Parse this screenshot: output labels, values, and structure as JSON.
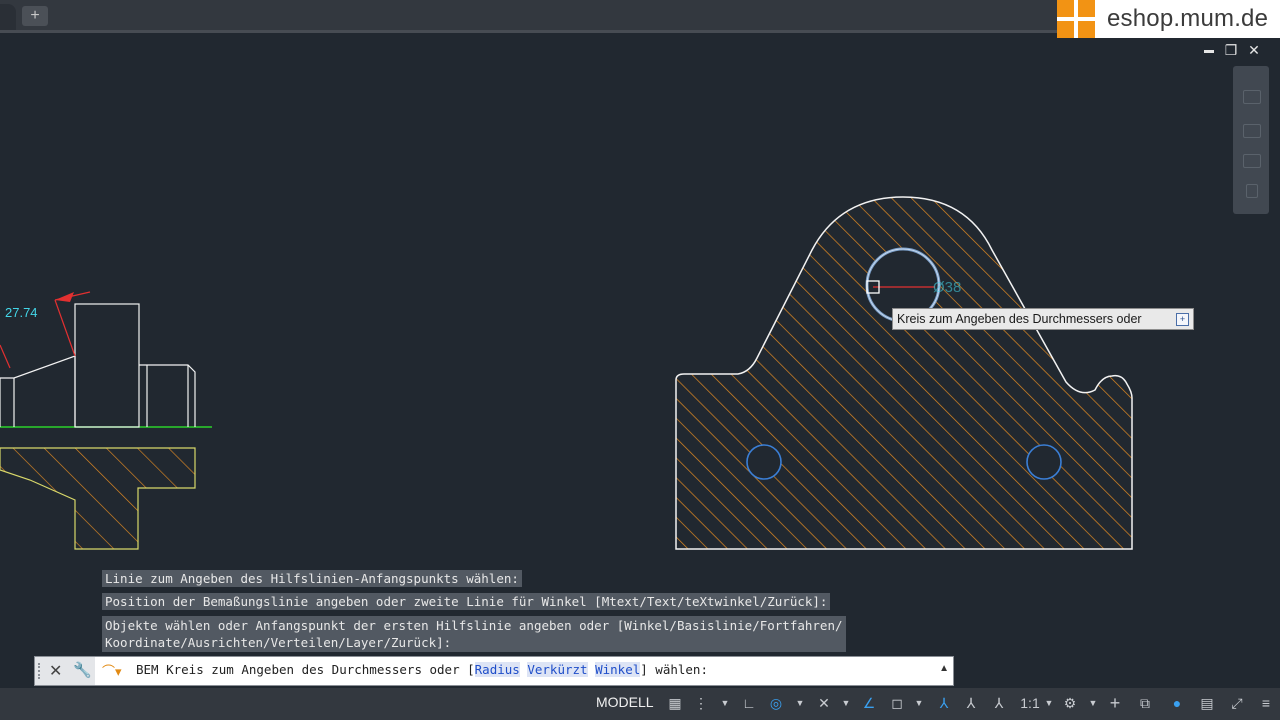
{
  "app": {
    "new_tab_label": "+",
    "brand_text": "eshop.mum.de"
  },
  "window_controls": {
    "minimize": "▬",
    "restore": "❐",
    "close": "✕"
  },
  "drawing": {
    "dimension_value": "27.74",
    "diameter_preview": "Ø38"
  },
  "tooltip": {
    "text": "Kreis zum Angeben des Durchmessers oder",
    "expand_icon": "+"
  },
  "command_history": [
    "Linie zum Angeben des Hilfslinien-Anfangspunkts wählen:",
    "Position der Bemaßungslinie angeben oder zweite Linie für Winkel [Mtext/Text/teXtwinkel/Zurück]:",
    "Objekte wählen oder Anfangspunkt der ersten Hilfslinie angeben oder [Winkel/Basislinie/Fortfahren/\nKoordinate/Ausrichten/Verteilen/Layer/Zurück]:"
  ],
  "command_line": {
    "prefix": "BEM Kreis zum Angeben des Durchmessers oder [",
    "options": [
      "Radius",
      "Verkürzt",
      "Winkel"
    ],
    "suffix": "] wählen:",
    "close_icon": "✕",
    "customize_icon": "🔧",
    "recent_icon": "⌒▾",
    "history_arrow": "▲"
  },
  "status_bar": {
    "model_label": "MODELL",
    "scale_label": "1:1",
    "icons": [
      "grid-icon",
      "snap-icon",
      "ortho-icon",
      "polar-icon",
      "osnap-icon",
      "otrack-icon",
      "lineweight-icon",
      "selection-cycling-icon",
      "annotation-visibility-icon",
      "auto-scale-icon",
      "annotation-scale-icon",
      "workspace-gear-icon",
      "plus-icon",
      "isolate-icon",
      "hardware-accel-icon",
      "clean-screen-icon",
      "customize-icon"
    ]
  },
  "colors": {
    "background": "#212830",
    "hatch": "#e08a22",
    "outline": "#f2f2f2",
    "dimension": "#43d6e8",
    "centerline_green": "#2ad12a",
    "yellow_outline": "#d8d86a",
    "red_arrow": "#e23030"
  }
}
